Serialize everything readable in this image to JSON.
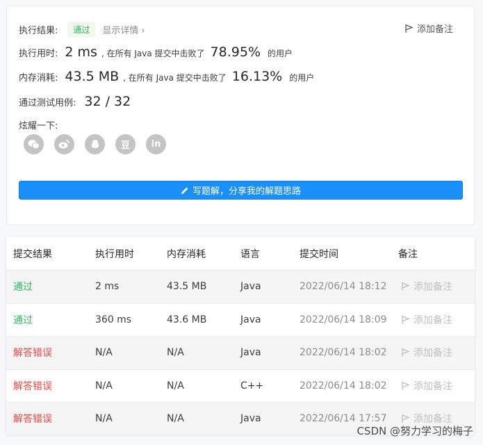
{
  "summary": {
    "result_label": "执行结果:",
    "result_value": "通过",
    "detail_link": "显示详情 ›",
    "add_note": "添加备注",
    "runtime_label": "执行用时:",
    "runtime_value": "2 ms",
    "runtime_text": ", 在所有 Java 提交中击败了",
    "runtime_pct": "78.95%",
    "users_suffix": "的用户",
    "memory_label": "内存消耗:",
    "memory_value": "43.5 MB",
    "memory_text": ", 在所有 Java 提交中击败了",
    "memory_pct": "16.13%",
    "tests_label": "通过测试用例:",
    "tests_value": "32 / 32",
    "share_label": "炫耀一下:",
    "share_icons": [
      "wechat-icon",
      "weibo-icon",
      "qq-icon",
      "douban-icon",
      "linkedin-icon"
    ],
    "douban_glyph": "豆",
    "linkedin_glyph": "in",
    "write_button": "写题解，分享我的解题思路"
  },
  "table": {
    "headers": [
      "提交结果",
      "执行用时",
      "内存消耗",
      "语言",
      "提交时间",
      "备注"
    ],
    "rows": [
      {
        "status": "通过",
        "time": "2 ms",
        "memory": "43.5 MB",
        "lang": "Java",
        "submitted": "2022/06/14 18:12",
        "note": "添加备注"
      },
      {
        "status": "通过",
        "time": "360 ms",
        "memory": "43.6 MB",
        "lang": "Java",
        "submitted": "2022/06/14 18:09",
        "note": "添加备注"
      },
      {
        "status": "解答错误",
        "time": "N/A",
        "memory": "N/A",
        "lang": "Java",
        "submitted": "2022/06/14 18:02",
        "note": "添加备注"
      },
      {
        "status": "解答错误",
        "time": "N/A",
        "memory": "N/A",
        "lang": "C++",
        "submitted": "2022/06/14 18:02",
        "note": "添加备注"
      },
      {
        "status": "解答错误",
        "time": "N/A",
        "memory": "N/A",
        "lang": "Java",
        "submitted": "2022/06/14 17:57",
        "note": "添加备注"
      }
    ]
  },
  "watermark": "CSDN @努力学习的梅子",
  "colors": {
    "accent": "#1a90ff",
    "pass": "#2db55d",
    "error": "#ef4743"
  }
}
